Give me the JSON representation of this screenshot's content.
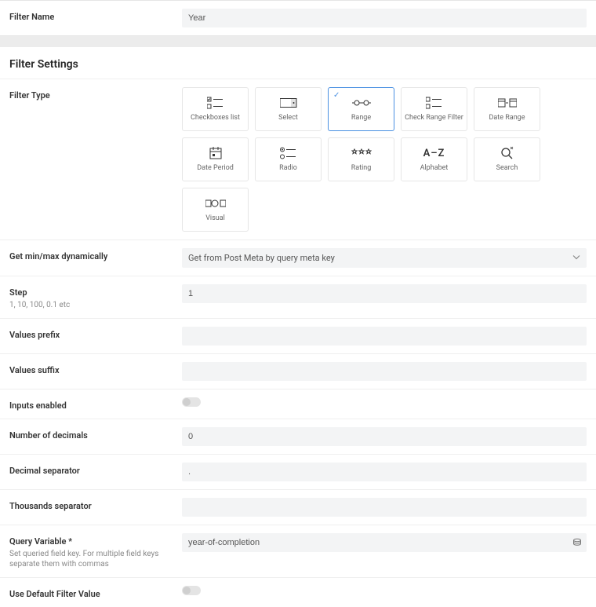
{
  "top": {
    "filter_name_label": "Filter Name",
    "filter_name_value": "Year"
  },
  "section_title": "Filter Settings",
  "filter_type_label": "Filter Type",
  "types": [
    {
      "key": "checkboxes",
      "label": "Checkboxes list",
      "selected": false
    },
    {
      "key": "select",
      "label": "Select",
      "selected": false
    },
    {
      "key": "range",
      "label": "Range",
      "selected": true
    },
    {
      "key": "check-range",
      "label": "Check Range Filter",
      "selected": false
    },
    {
      "key": "date-range",
      "label": "Date Range",
      "selected": false
    },
    {
      "key": "date-period",
      "label": "Date Period",
      "selected": false
    },
    {
      "key": "radio",
      "label": "Radio",
      "selected": false
    },
    {
      "key": "rating",
      "label": "Rating",
      "selected": false
    },
    {
      "key": "alphabet",
      "label": "Alphabet",
      "selected": false
    },
    {
      "key": "search",
      "label": "Search",
      "selected": false
    },
    {
      "key": "visual",
      "label": "Visual",
      "selected": false
    }
  ],
  "dyn": {
    "label": "Get min/max dynamically",
    "value": "Get from Post Meta by query meta key"
  },
  "step": {
    "label": "Step",
    "hint": "1, 10, 100, 0.1 etc",
    "value": "1"
  },
  "prefix": {
    "label": "Values prefix",
    "value": ""
  },
  "suffix": {
    "label": "Values suffix",
    "value": ""
  },
  "inputs_enabled": {
    "label": "Inputs enabled",
    "value": false
  },
  "decimals": {
    "label": "Number of decimals",
    "value": "0"
  },
  "dec_sep": {
    "label": "Decimal separator",
    "value": "."
  },
  "thou_sep": {
    "label": "Thousands separator",
    "value": ""
  },
  "query_var": {
    "label": "Query Variable *",
    "hint": "Set queried field key. For multiple field keys separate them with commas",
    "value": "year-of-completion"
  },
  "use_default": {
    "label": "Use Default Filter Value",
    "value": false
  }
}
